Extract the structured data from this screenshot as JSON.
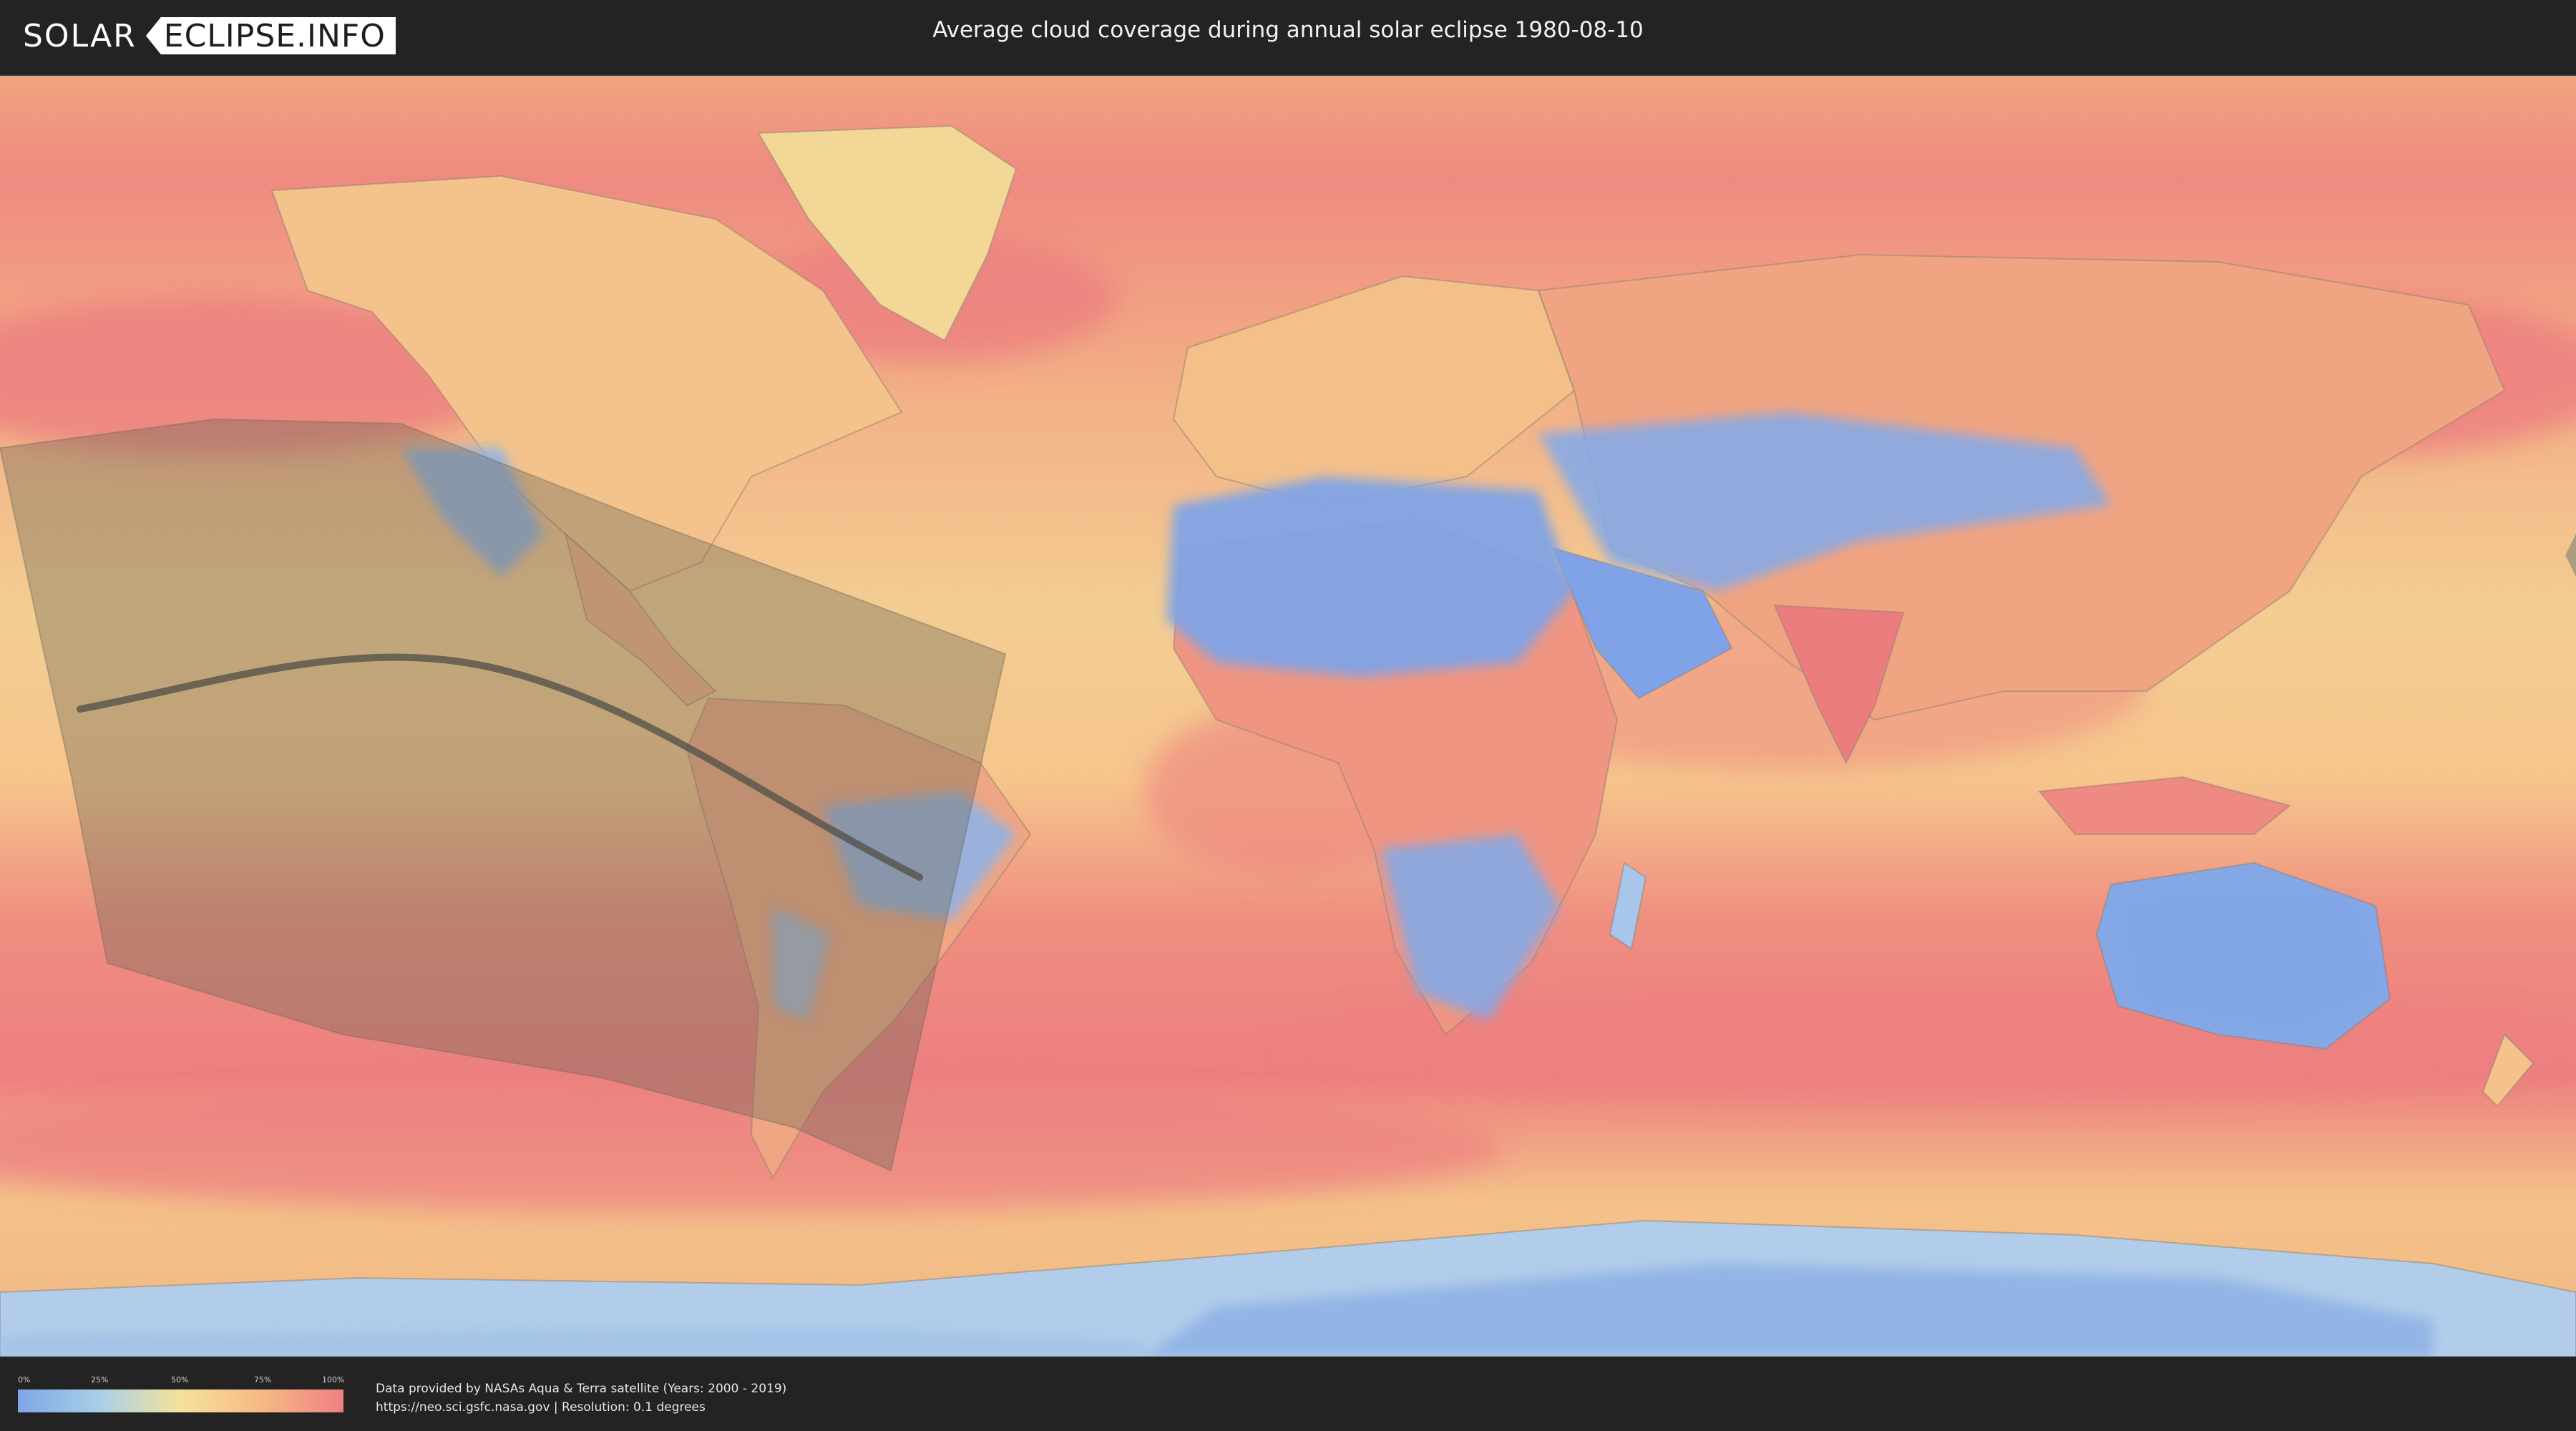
{
  "header": {
    "logo_part1": "SOLAR",
    "logo_part2": "ECLIPSE.INFO",
    "title": "Average cloud coverage during annual solar eclipse 1980-08-10"
  },
  "legend": {
    "ticks": [
      "0%",
      "25%",
      "50%",
      "75%",
      "100%"
    ],
    "colors": [
      "#7fa6e6",
      "#a8cfe8",
      "#f5e29a",
      "#f6b985",
      "#ee8083"
    ]
  },
  "footer": {
    "credit_line1": "Data provided by NASAs Aqua & Terra satellite (Years: 2000 - 2019)",
    "credit_line2": "https://neo.sci.gsfc.nasa.gov | Resolution: 0.1 degrees"
  }
}
